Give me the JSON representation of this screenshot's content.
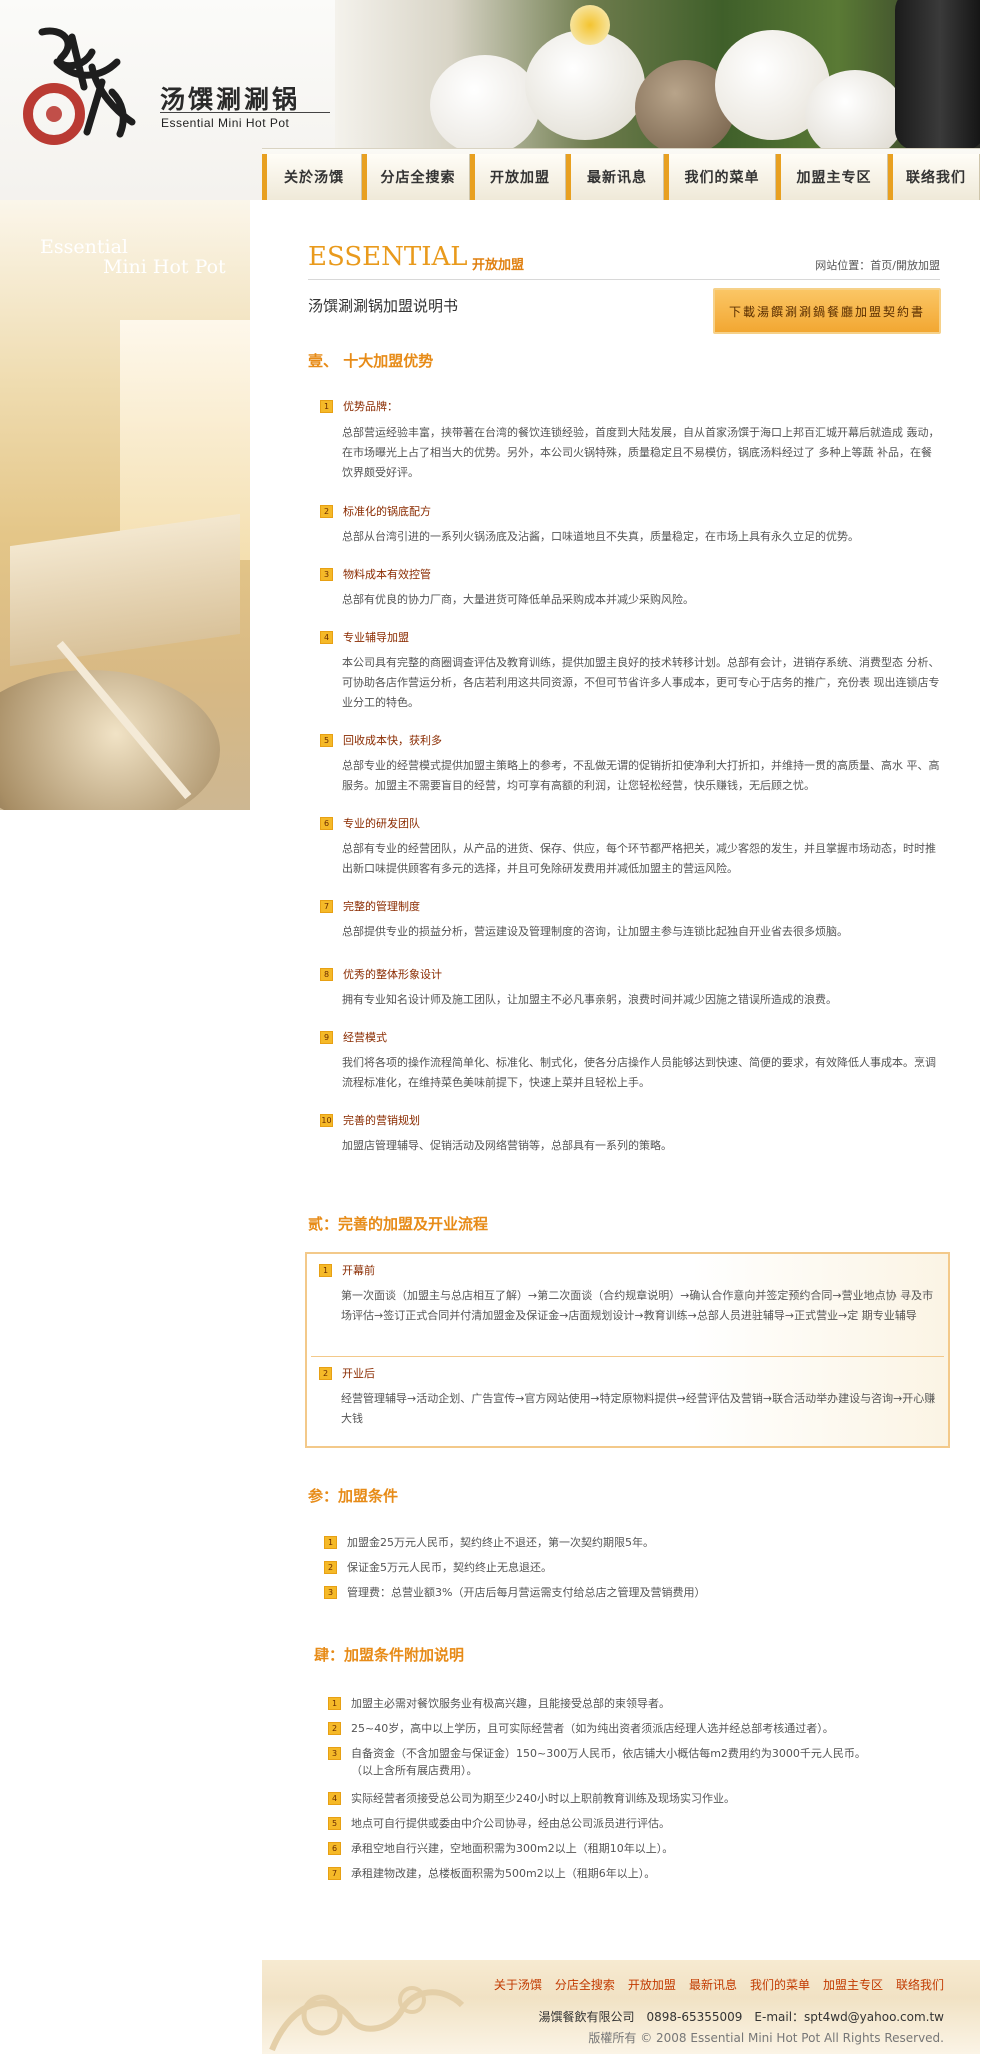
{
  "brand": {
    "name_cn": "汤馔涮涮锅",
    "name_en": "Essential Mini Hot Pot"
  },
  "nav": [
    {
      "label": "关於汤馔"
    },
    {
      "label": "分店全搜索"
    },
    {
      "label": "开放加盟"
    },
    {
      "label": "最新讯息"
    },
    {
      "label": "我们的菜单"
    },
    {
      "label": "加盟主专区"
    },
    {
      "label": "联络我们"
    }
  ],
  "left_photo": {
    "line1": "Essential",
    "line2": "Mini Hot Pot"
  },
  "page": {
    "title_en": "ESSENTIAL",
    "title_cn": "开放加盟",
    "breadcrumb_prefix": "网站位置：",
    "breadcrumb_home": "首页",
    "breadcrumb_sep": "/",
    "breadcrumb_current": "開放加盟",
    "doc_title": "汤馔涮涮锅加盟说明书",
    "download_label": "下載湯饌涮涮鍋餐廳加盟契約書"
  },
  "section1": {
    "heading": "壹、 十大加盟优势",
    "items": [
      {
        "num": "1",
        "title": "优势品牌：",
        "body": "总部营运经验丰富，挟带著在台湾的餐饮连锁经验，首度到大陆发展，自从首家汤馔于海口上邦百汇城开幕后就造成 轰动，在市场曝光上占了相当大的优势。另外，本公司火锅特殊，质量稳定且不易模仿，锅底汤料经过了 多种上等蔬 补品，在餐饮界颇受好评。"
      },
      {
        "num": "2",
        "title": "标准化的锅底配方",
        "body": "总部从台湾引进的一系列火锅汤底及沾酱，口味道地且不失真，质量稳定，在市场上具有永久立足的优势。"
      },
      {
        "num": "3",
        "title": "物料成本有效控管",
        "body": "总部有优良的协力厂商，大量进货可降低单品采购成本并减少采购风险。"
      },
      {
        "num": "4",
        "title": "专业辅导加盟",
        "body": "本公司具有完整的商圈调查评估及教育训练，提供加盟主良好的技术转移计划。总部有会计，进销存系统、消费型态 分析、可协助各店作营运分析，各店若利用这共同资源，不但可节省许多人事成本，更可专心于店务的推广，充份表 现出连锁店专业分工的特色。"
      },
      {
        "num": "5",
        "title": "回收成本快，获利多",
        "body": "总部专业的经营模式提供加盟主策略上的参考，不乱做无谓的促销折扣使净利大打折扣，并维持一贯的高质量、高水 平、高服务。加盟主不需要盲目的经营，均可享有高额的利润，让您轻松经营，快乐赚钱，无后顾之忧。"
      },
      {
        "num": "6",
        "title": "专业的研发团队",
        "body": "总部有专业的经营团队，从产品的进货、保存、供应，每个环节都严格把关，减少客怨的发生，并且掌握市场动态，时时推出新口味提供顾客有多元的选择，并且可免除研发费用并减低加盟主的营运风险。"
      },
      {
        "num": "7",
        "title": "完整的管理制度",
        "body": "总部提供专业的损益分析，营运建设及管理制度的咨询，让加盟主参与连锁比起独自开业省去很多烦脑。"
      },
      {
        "num": "8",
        "title": "优秀的整体形象设计",
        "body": "拥有专业知名设计师及施工团队，让加盟主不必凡事亲躬，浪费时间并减少因施之错误所造成的浪费。"
      },
      {
        "num": "9",
        "title": "经营模式",
        "body": "我们将各项的操作流程简单化、标准化、制式化，使各分店操作人员能够达到快速、简便的要求，有效降低人事成本。烹调流程标准化，在维持菜色美味前提下，快速上菜并且轻松上手。"
      },
      {
        "num": "10",
        "title": "完善的营销规划",
        "body": "加盟店管理辅导、促销活动及网络营销等，总部具有一系列的策略。"
      }
    ]
  },
  "section2": {
    "heading": "贰：完善的加盟及开业流程",
    "items": [
      {
        "num": "1",
        "title": "开幕前",
        "body": "第一次面谈（加盟主与总店相互了解）→第二次面谈（合约规章说明）→确认合作意向并签定预约合同→营业地点协 寻及市场评估→签订正式合同并付清加盟金及保证金→店面规划设计→教育训练→总部人员进驻辅导→正式营业→定 期专业辅导"
      },
      {
        "num": "2",
        "title": "开业后",
        "body": "经营管理辅导→活动企划、广告宣传→官方网站使用→特定原物料提供→经营评估及营销→联合活动举办建设与咨询→开心赚大钱"
      }
    ]
  },
  "section3": {
    "heading": "参：加盟条件",
    "items": [
      {
        "num": "1",
        "text": "加盟金25万元人民币，契约终止不退还，第一次契约期限5年。"
      },
      {
        "num": "2",
        "text": "保证金5万元人民币，契约终止无息退还。"
      },
      {
        "num": "3",
        "text": "管理费：总营业额3%（开店后每月营运需支付给总店之管理及营销费用）"
      }
    ]
  },
  "section4": {
    "heading": "肆：加盟条件附加说明",
    "items": [
      {
        "num": "1",
        "text": "加盟主必需对餐饮服务业有极高兴趣，且能接受总部的束领导者。"
      },
      {
        "num": "2",
        "text": "25~40岁，高中以上学历，且可实际经营者（如为纯出资者须派店经理人选并经总部考核通过者）。"
      },
      {
        "num": "3",
        "text": "自备资金（不含加盟金与保证金）150~300万人民币，依店铺大小概估每m2费用约为3000千元人民币。",
        "text2": "（以上含所有展店费用）。"
      },
      {
        "num": "4",
        "text": "实际经营者须接受总公司为期至少240小时以上职前教育训练及现场实习作业。"
      },
      {
        "num": "5",
        "text": "地点可自行提供或委由中介公司协寻，经由总公司派员进行评估。"
      },
      {
        "num": "6",
        "text": "承租空地自行兴建，空地面积需为300m2以上（租期10年以上）。"
      },
      {
        "num": "7",
        "text": "承租建物改建，总楼板面积需为500m2以上（租期6年以上）。"
      }
    ]
  },
  "footer": {
    "nav": [
      {
        "label": "关于汤馔"
      },
      {
        "label": "分店全搜索"
      },
      {
        "label": "开放加盟"
      },
      {
        "label": "最新讯息"
      },
      {
        "label": "我们的菜单"
      },
      {
        "label": "加盟主专区"
      },
      {
        "label": "联络我们"
      }
    ],
    "company": "湯馔餐飲有限公司　0898-65355009　E-mail：spt4wd@yahoo.com.tw",
    "copyright": "版權所有 © 2008 Essential Mini Hot Pot  All Rights Reserved."
  },
  "colors": {
    "accent": "#e99a1c",
    "item_title": "#8a2b00",
    "footer_link": "#c23a00"
  }
}
